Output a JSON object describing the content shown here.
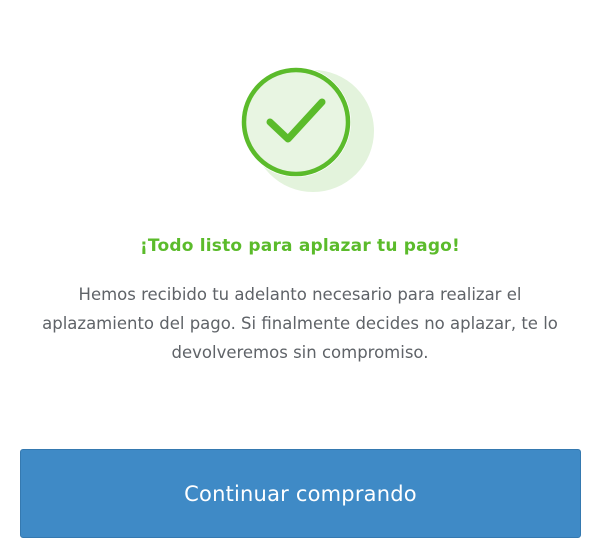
{
  "icons": {
    "success": "check-circle-icon"
  },
  "colors": {
    "accent_green": "#5bbb2b",
    "icon_fill": "#e3f3dc",
    "button_blue": "#3f8ac6",
    "text_gray": "#5f6368"
  },
  "confirmation": {
    "title": "¡Todo listo para aplazar tu pago!",
    "message": "Hemos recibido tu adelanto necesario para realizar el aplazamiento del pago. Si finalmente decides no aplazar, te lo devolveremos sin compromiso."
  },
  "actions": {
    "continue_label": "Continuar comprando"
  }
}
